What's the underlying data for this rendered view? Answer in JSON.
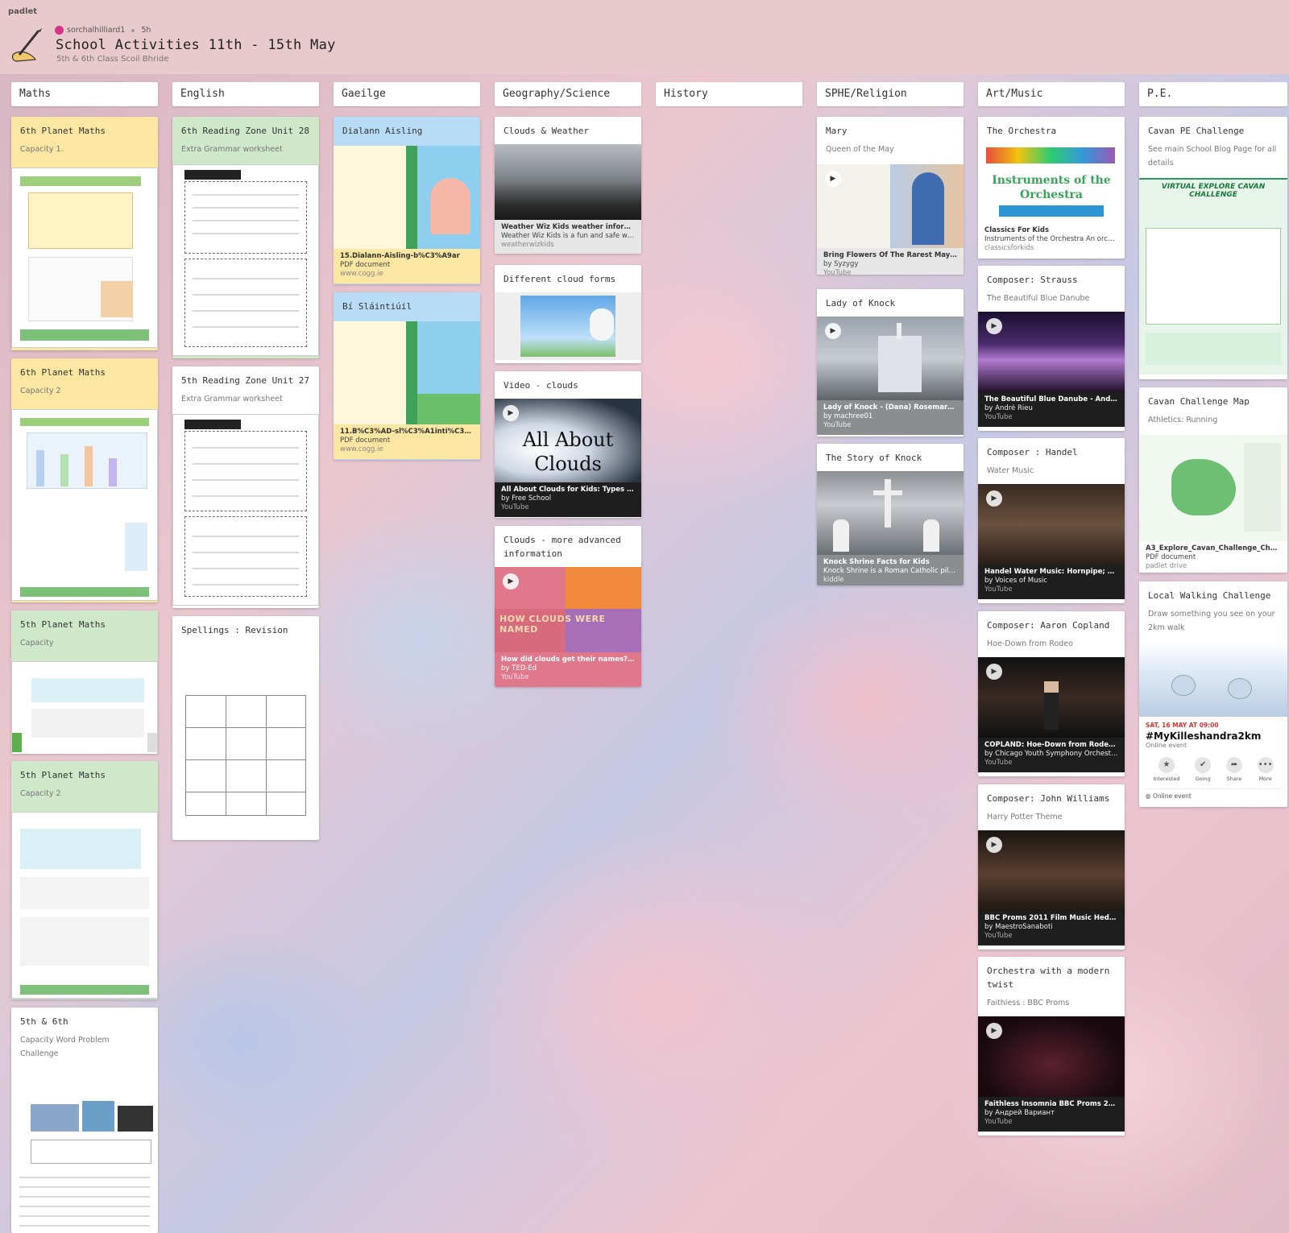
{
  "brand": "padlet",
  "header": {
    "author": "sorchalhilliard1",
    "time": "5h",
    "title": "School Activities 11th - 15th May",
    "subtitle": "5th & 6th Class Scoil Bhride"
  },
  "columns": [
    "Maths",
    "English",
    "Gaeilge",
    "Geography/Science",
    "History",
    "SPHE/Religion",
    "Art/Music",
    "P.E."
  ],
  "maths": [
    {
      "title": "6th Planet Maths",
      "body": "Capacity 1."
    },
    {
      "title": "6th Planet Maths",
      "body": "Capacity 2"
    },
    {
      "title": "5th Planet Maths",
      "body": "Capacity"
    },
    {
      "title": "5th Planet Maths",
      "body": "Capacity 2"
    },
    {
      "title": "5th & 6th",
      "body": "Capacity Word Problem Challenge"
    }
  ],
  "english": [
    {
      "title": "6th Reading Zone Unit 28",
      "body": "Extra Grammar worksheet"
    },
    {
      "title": "5th Reading Zone Unit 27",
      "body": "Extra Grammar worksheet"
    },
    {
      "title": "Spellings : Revision",
      "body": ""
    }
  ],
  "gaeilge": [
    {
      "title": "Dialann Aisling",
      "file": "15.Dialann-Aisling-b%C3%A9ar",
      "type": "PDF document",
      "src": "www.cogg.ie"
    },
    {
      "title": "Bí Sláintiúil",
      "file": "11.B%C3%AD-sl%C3%A1inti%C3%BAil-b...",
      "type": "PDF document",
      "src": "www.cogg.ie"
    }
  ],
  "geo": [
    {
      "title": "Clouds & Weather",
      "t": "Weather Wiz Kids weather information f...",
      "s": "Weather Wiz Kids is a fun and safe webs...",
      "src": "weatherwizkids"
    },
    {
      "title": "Different cloud forms"
    },
    {
      "title": "Video - clouds",
      "overlay": "All About Clouds",
      "t": "All About Clouds for Kids: Types and Na...",
      "s": "by Free School",
      "src": "YouTube"
    },
    {
      "title": "Clouds - more advanced information",
      "overlay": "HOW CLOUDS WERE NAMED",
      "t": "How did clouds get their names? - Richa...",
      "s": "by TED-Ed",
      "src": "YouTube"
    }
  ],
  "sphe": [
    {
      "title": "Mary",
      "body": "Queen of the May",
      "t": "Bring Flowers Of The Rarest May Crowni...",
      "s": "by Syzygy",
      "src": "YouTube"
    },
    {
      "title": "Lady of Knock",
      "t": "Lady of Knock - (Dana) Rosemary Scallon",
      "s": "by machree01",
      "src": "YouTube"
    },
    {
      "title": "The Story of Knock",
      "t": "Knock Shrine Facts for Kids",
      "s": "Knock Shrine is a Roman Catholic pilgri...",
      "src": "kiddle"
    }
  ],
  "art": [
    {
      "title": "The Orchestra",
      "overlay": "Instruments of the Orchestra",
      "t": "Classics For Kids",
      "s": "Instruments of the Orchestra An orchestr...",
      "src": "classicsforkids"
    },
    {
      "title": "Composer: Strauss",
      "body": "The Beautiful Blue Danube",
      "t": "The Beautiful Blue Danube - André Rieu",
      "s": "by André Rieu",
      "src": "YouTube"
    },
    {
      "title": "Composer : Handel",
      "body": "Water Music",
      "t": "Handel Water Music: Hornpipe; Festspie...",
      "s": "by Voices of Music",
      "src": "YouTube"
    },
    {
      "title": "Composer: Aaron Copland",
      "body": "Hoe-Down from Rodeo",
      "t": "COPLAND: Hoe-Down from Rodeo | CYS...",
      "s": "by Chicago Youth Symphony Orchestras",
      "src": "YouTube"
    },
    {
      "title": "Composer: John Williams",
      "body": "Harry Potter Theme",
      "t": "BBC Proms 2011 Film Music Hedwig's T...",
      "s": "by MaestroSanaboti",
      "src": "YouTube"
    },
    {
      "title": "Orchestra with a modern twist",
      "body": "Faithless : BBC Proms",
      "t": "Faithless Insomnia BBC Proms 2015 Se...",
      "s": "by Андрей Вариант",
      "src": "YouTube"
    }
  ],
  "pe": [
    {
      "title": "Cavan PE Challenge",
      "body": "See main School Blog Page for all details",
      "overlay": "VIRTUAL EXPLORE CAVAN CHALLENGE"
    },
    {
      "title": "Cavan Challenge Map",
      "body": "Athletics: Running",
      "file": "A3_Explore_Cavan_Challenge_Chart_FIN...",
      "type": "PDF document",
      "src": "padlet drive"
    },
    {
      "title": "Local Walking Challenge",
      "body": "Draw something you see on your 2km walk",
      "date": "SAT, 16 MAY AT 09:00",
      "event": "#MyKilleshandra2km",
      "etype": "Online event",
      "actions": [
        "Interested",
        "Going",
        "Share",
        "More"
      ],
      "foot": "Online event"
    }
  ],
  "colors": {
    "header_bg": "#e8c9cc",
    "yellow": "#fbe7a1",
    "green": "#cfe8c9",
    "blue": "#b8dcf5",
    "avatar": "#d6338a"
  }
}
